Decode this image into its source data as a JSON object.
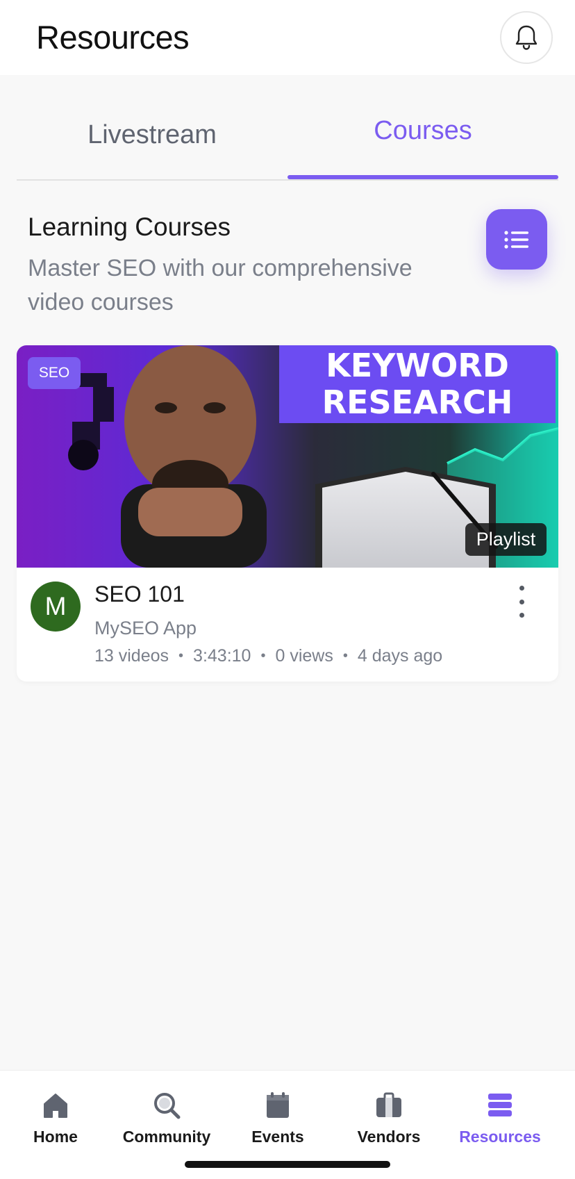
{
  "header": {
    "title": "Resources",
    "bell_icon": "bell-icon"
  },
  "tabs": [
    {
      "label": "Livestream",
      "active": false
    },
    {
      "label": "Courses",
      "active": true
    }
  ],
  "section": {
    "title": "Learning Courses",
    "subtitle": "Master SEO with our comprehensive video courses",
    "list_icon": "list-icon"
  },
  "course": {
    "tag": "SEO",
    "thumbnail_text": [
      "KEYWORD",
      "RESEARCH"
    ],
    "badge": "Playlist",
    "avatar_initial": "M",
    "title": "SEO 101",
    "channel": "MySEO App",
    "meta": {
      "videos": "13 videos",
      "duration": "3:43:10",
      "views": "0 views",
      "age": "4 days ago"
    },
    "more_icon": "more-vertical-icon"
  },
  "bottom_nav": [
    {
      "label": "Home",
      "icon": "home-icon",
      "active": false
    },
    {
      "label": "Community",
      "icon": "search-icon",
      "active": false
    },
    {
      "label": "Events",
      "icon": "calendar-icon",
      "active": false
    },
    {
      "label": "Vendors",
      "icon": "briefcase-icon",
      "active": false
    },
    {
      "label": "Resources",
      "icon": "layers-icon",
      "active": true
    }
  ],
  "colors": {
    "accent": "#7b5cf0",
    "avatar": "#2e6a1f",
    "muted_text": "#7a7f8a",
    "background": "#f8f8f8"
  }
}
